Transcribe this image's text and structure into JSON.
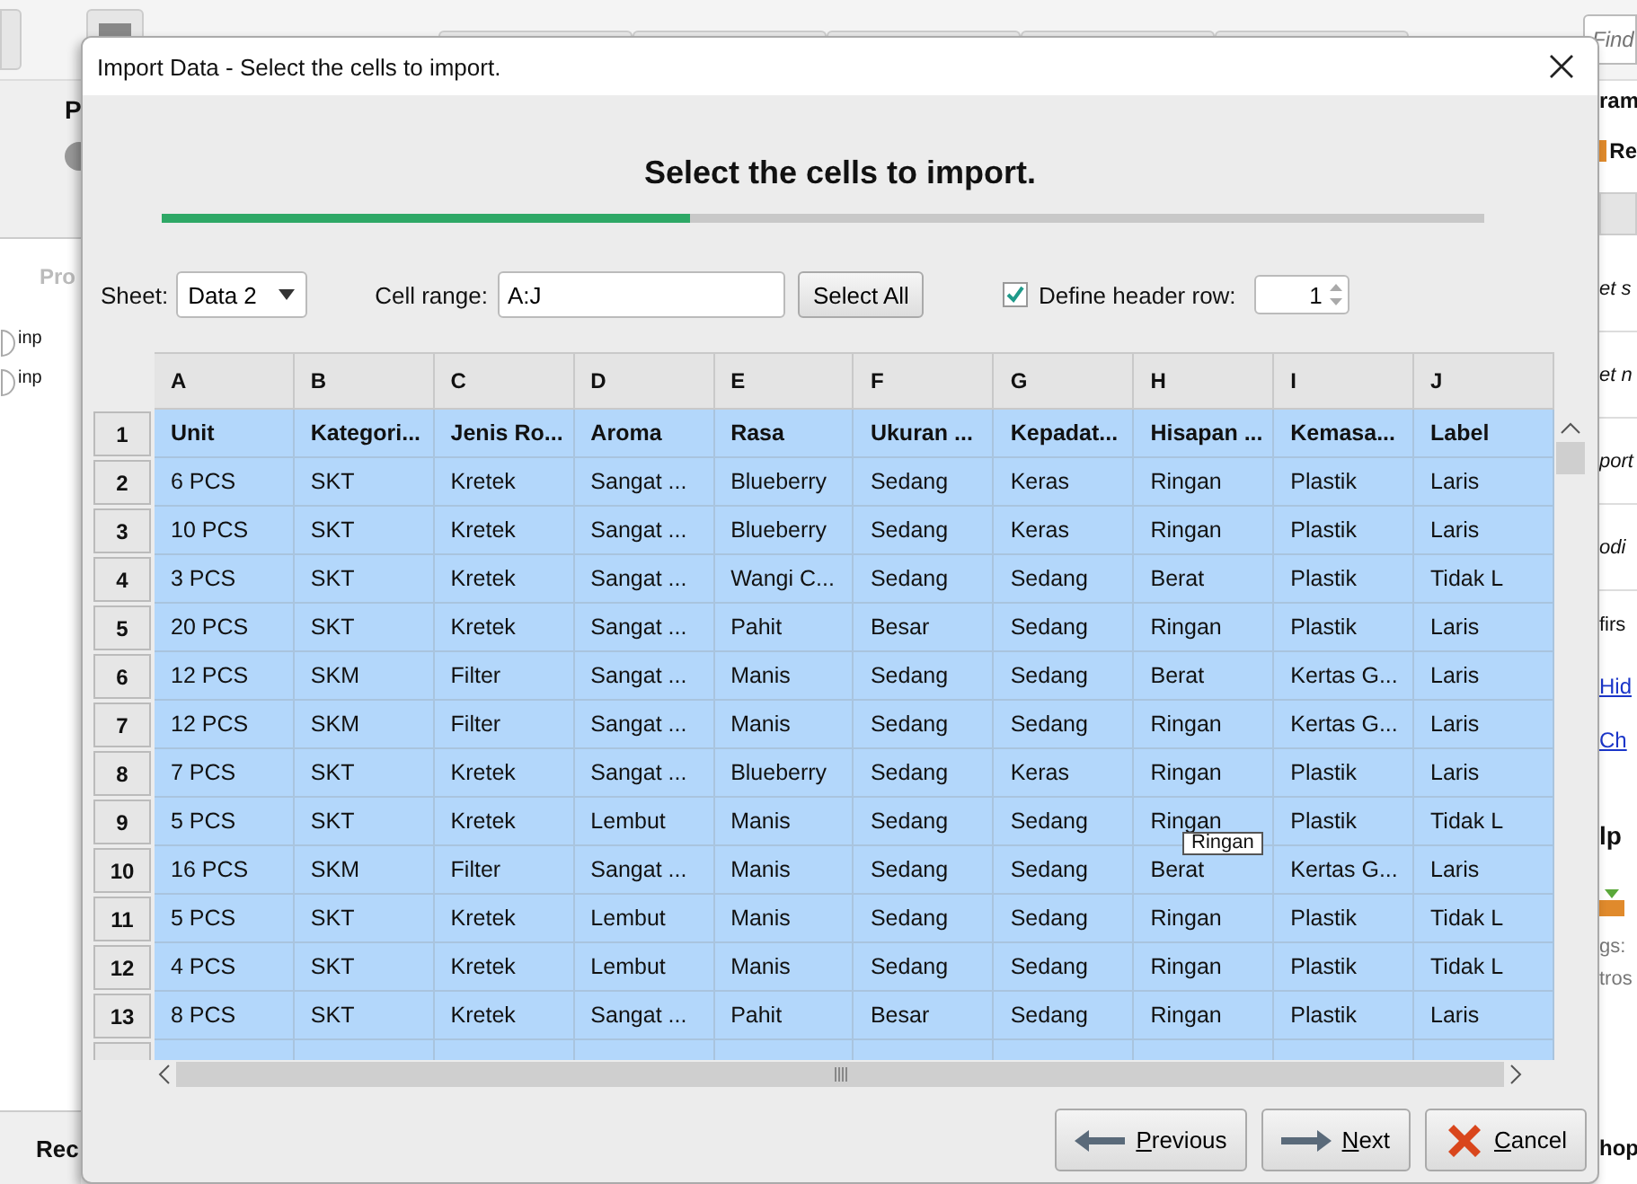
{
  "background": {
    "find_placeholder": "Find",
    "left": {
      "title": "P",
      "section": "Pro",
      "ports": [
        "inp",
        "inp"
      ],
      "footer": "Rec"
    },
    "right": {
      "title": "ram",
      "item": "Re",
      "rows": [
        "et s",
        "et n",
        "port",
        "odi",
        "firs"
      ],
      "links": [
        "Hid",
        "Ch"
      ],
      "help": "lp",
      "notes": [
        "gs:",
        "tros"
      ],
      "footer": "hop"
    }
  },
  "dialog": {
    "title": "Import Data - Select the cells to import.",
    "heading": "Select the cells to import.",
    "progress": {
      "level": 0.4
    },
    "sheet": {
      "label": "Sheet:",
      "value": "Data 2"
    },
    "cell_range": {
      "label": "Cell range:",
      "value": "A:J"
    },
    "select_all": "Select All",
    "header_row": {
      "label": "Define header row:",
      "checked": true,
      "value": "1"
    },
    "table": {
      "columns": [
        "A",
        "B",
        "C",
        "D",
        "E",
        "F",
        "G",
        "H",
        "I",
        "J"
      ],
      "rows": [
        {
          "number": "1",
          "header": true,
          "selected": true,
          "cells": [
            "Unit",
            "Kategori...",
            "Jenis Ro...",
            "Aroma",
            "Rasa",
            "Ukuran ...",
            "Kepadat...",
            "Hisapan ...",
            "Kemasa...",
            "Label"
          ]
        },
        {
          "number": "2",
          "header": false,
          "selected": true,
          "cells": [
            "6 PCS",
            "SKT",
            "Kretek",
            "Sangat ...",
            "Blueberry",
            "Sedang",
            "Keras",
            "Ringan",
            "Plastik",
            "Laris"
          ]
        },
        {
          "number": "3",
          "header": false,
          "selected": true,
          "cells": [
            "10 PCS",
            "SKT",
            "Kretek",
            "Sangat ...",
            "Blueberry",
            "Sedang",
            "Keras",
            "Ringan",
            "Plastik",
            "Laris"
          ]
        },
        {
          "number": "4",
          "header": false,
          "selected": true,
          "cells": [
            "3 PCS",
            "SKT",
            "Kretek",
            "Sangat ...",
            "Wangi C...",
            "Sedang",
            "Sedang",
            "Berat",
            "Plastik",
            "Tidak L"
          ]
        },
        {
          "number": "5",
          "header": false,
          "selected": true,
          "cells": [
            "20 PCS",
            "SKT",
            "Kretek",
            "Sangat ...",
            "Pahit",
            "Besar",
            "Sedang",
            "Ringan",
            "Plastik",
            "Laris"
          ]
        },
        {
          "number": "6",
          "header": false,
          "selected": true,
          "cells": [
            "12 PCS",
            "SKM",
            "Filter",
            "Sangat ...",
            "Manis",
            "Sedang",
            "Sedang",
            "Berat",
            "Kertas G...",
            "Laris"
          ]
        },
        {
          "number": "7",
          "header": false,
          "selected": true,
          "cells": [
            "12 PCS",
            "SKM",
            "Filter",
            "Sangat ...",
            "Manis",
            "Sedang",
            "Sedang",
            "Ringan",
            "Kertas G...",
            "Laris"
          ]
        },
        {
          "number": "8",
          "header": false,
          "selected": true,
          "cells": [
            "7 PCS",
            "SKT",
            "Kretek",
            "Sangat ...",
            "Blueberry",
            "Sedang",
            "Keras",
            "Ringan",
            "Plastik",
            "Laris"
          ]
        },
        {
          "number": "9",
          "header": false,
          "selected": true,
          "cells": [
            "5 PCS",
            "SKT",
            "Kretek",
            "Lembut",
            "Manis",
            "Sedang",
            "Sedang",
            "Ringan",
            "Plastik",
            "Tidak L"
          ]
        },
        {
          "number": "10",
          "header": false,
          "selected": true,
          "cells": [
            "16 PCS",
            "SKM",
            "Filter",
            "Sangat ...",
            "Manis",
            "Sedang",
            "Sedang",
            "Berat",
            "Kertas G...",
            "Laris"
          ]
        },
        {
          "number": "11",
          "header": false,
          "selected": true,
          "cells": [
            "5 PCS",
            "SKT",
            "Kretek",
            "Lembut",
            "Manis",
            "Sedang",
            "Sedang",
            "Ringan",
            "Plastik",
            "Tidak L"
          ]
        },
        {
          "number": "12",
          "header": false,
          "selected": true,
          "cells": [
            "4 PCS",
            "SKT",
            "Kretek",
            "Lembut",
            "Manis",
            "Sedang",
            "Sedang",
            "Ringan",
            "Plastik",
            "Tidak L"
          ]
        },
        {
          "number": "13",
          "header": false,
          "selected": true,
          "cells": [
            "8 PCS",
            "SKT",
            "Kretek",
            "Sangat ...",
            "Pahit",
            "Besar",
            "Sedang",
            "Ringan",
            "Plastik",
            "Laris"
          ]
        }
      ]
    },
    "tooltip": "Ringan",
    "buttons": [
      {
        "kind": "previous",
        "label": "Previous"
      },
      {
        "kind": "next",
        "label": "Next"
      },
      {
        "kind": "cancel",
        "label": "Cancel"
      }
    ]
  }
}
